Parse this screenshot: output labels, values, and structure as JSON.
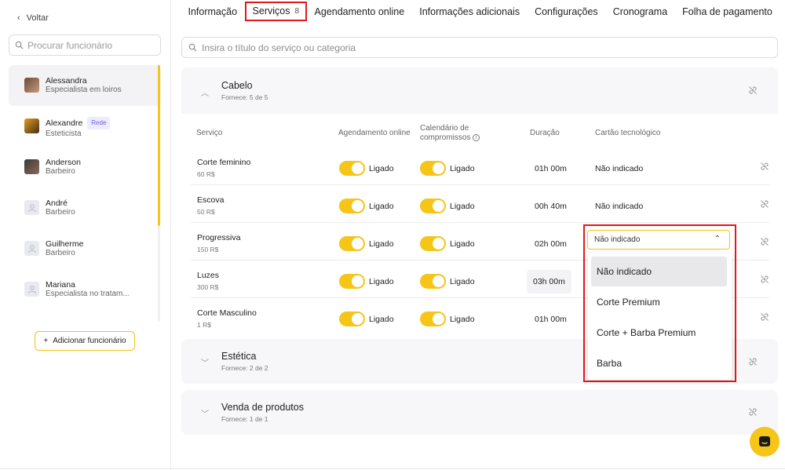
{
  "sidebar": {
    "back_label": "Voltar",
    "search_placeholder": "Procurar funcionário",
    "employees": [
      {
        "name": "Alessandra",
        "role": "Especialista em loiros",
        "badge": ""
      },
      {
        "name": "Alexandre",
        "role": "Esteticista",
        "badge": "Rede"
      },
      {
        "name": "Anderson",
        "role": "Barbeiro",
        "badge": ""
      },
      {
        "name": "André",
        "role": "Barbeiro",
        "badge": ""
      },
      {
        "name": "Guilherme",
        "role": "Barbeiro",
        "badge": ""
      },
      {
        "name": "Mariana",
        "role": "Especialista no tratam...",
        "badge": ""
      }
    ],
    "add_label": "Adicionar funcionário"
  },
  "tabs": [
    {
      "label": "Informação"
    },
    {
      "label": "Serviços",
      "count": "8"
    },
    {
      "label": "Agendamento online"
    },
    {
      "label": "Informações adicionais"
    },
    {
      "label": "Configurações"
    },
    {
      "label": "Cronograma"
    },
    {
      "label": "Folha de pagamento"
    }
  ],
  "main_search_placeholder": "Insira o título do serviço ou categoria",
  "categories": [
    {
      "title": "Cabelo",
      "subtitle": "Fornece: 5 de 5"
    },
    {
      "title": "Estética",
      "subtitle": "Fornece: 2 de 2"
    },
    {
      "title": "Venda de produtos",
      "subtitle": "Fornece: 1 de 1"
    }
  ],
  "columns": {
    "service": "Serviço",
    "online": "Agendamento online",
    "calendar": "Calendário de compromissos",
    "duration": "Duração",
    "tech_card": "Cartão tecnológico"
  },
  "toggle_label": "Ligado",
  "services": [
    {
      "name": "Corte feminino",
      "price": "60 R$",
      "duration": "01h 00m",
      "tech": "Não indicado"
    },
    {
      "name": "Escova",
      "price": "50 R$",
      "duration": "00h 40m",
      "tech": "Não indicado"
    },
    {
      "name": "Progressiva",
      "price": "150 R$",
      "duration": "02h 00m",
      "tech": ""
    },
    {
      "name": "Luzes",
      "price": "300 R$",
      "duration": "03h 00m",
      "tech": ""
    },
    {
      "name": "Corte Masculino",
      "price": "1 R$",
      "duration": "01h 00m",
      "tech": ""
    }
  ],
  "select": {
    "value": "Não indicado",
    "options": [
      "Não indicado",
      "Corte Premium",
      "Corte + Barba Premium",
      "Barba"
    ]
  },
  "colors": {
    "accent": "#f5c518",
    "highlight": "#e5161a"
  }
}
